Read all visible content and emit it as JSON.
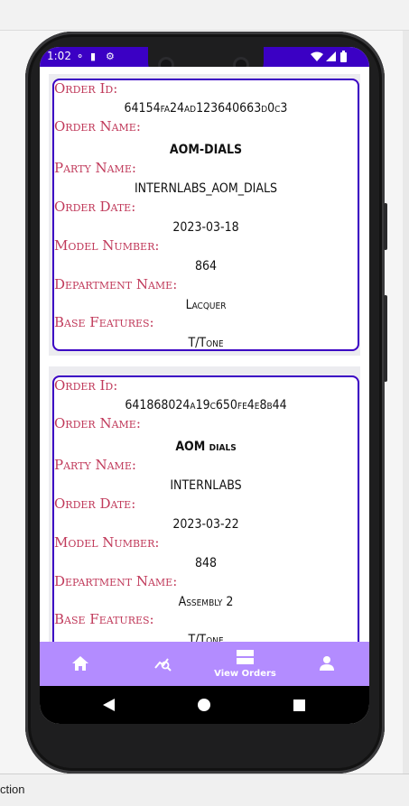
{
  "ide": {
    "bottom_text": "ction"
  },
  "status_bar": {
    "time": "1:02"
  },
  "orders": [
    {
      "order_id_label": "Order Id:",
      "order_id": "64154fa24ad123640663d0c3",
      "order_name_label": "Order Name:",
      "order_name": "AOM-DIALS",
      "party_name_label": "Party Name:",
      "party_name": "INTERNLABS_AOM_DIALS",
      "order_date_label": "Order Date:",
      "order_date": "2023-03-18",
      "model_number_label": "Model Number:",
      "model_number": "864",
      "department_name_label": "Department Name:",
      "department_name": "Lacquer",
      "base_features_label": "Base Features:",
      "base_features": "T/Tone"
    },
    {
      "order_id_label": "Order Id:",
      "order_id": "641868024a19c650fe4e8b44",
      "order_name_label": "Order Name:",
      "order_name": "AOM dials",
      "party_name_label": "Party Name:",
      "party_name": "INTERNLABS",
      "order_date_label": "Order Date:",
      "order_date": "2023-03-22",
      "model_number_label": "Model Number:",
      "model_number": "848",
      "department_name_label": "Department Name:",
      "department_name": "Assembly 2",
      "base_features_label": "Base Features:",
      "base_features": "T/Tone"
    }
  ],
  "bottom_nav": {
    "items": [
      {
        "icon": "home-icon",
        "label": ""
      },
      {
        "icon": "analytics-search-icon",
        "label": ""
      },
      {
        "icon": "view-orders-icon",
        "label": "View Orders"
      },
      {
        "icon": "person-icon",
        "label": ""
      }
    ]
  },
  "colors": {
    "accent": "#3b00c4",
    "label": "#c0395a",
    "nav_bar": "#b38cff"
  }
}
